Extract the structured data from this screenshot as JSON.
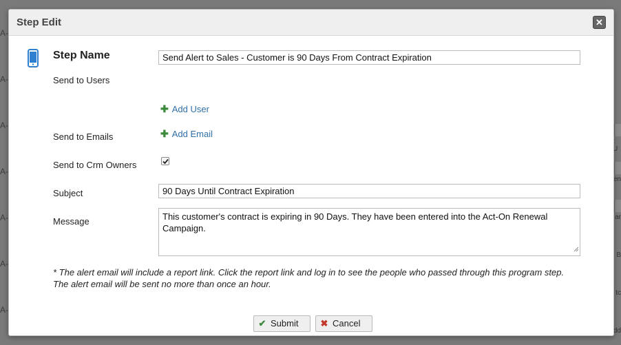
{
  "background": {
    "left_fragments": [
      "A-",
      "A-",
      "A-",
      "A-",
      "A-",
      "A-",
      "A-"
    ],
    "right_fragments": [
      "t U",
      "en",
      "ar",
      "B",
      "tc",
      "dd"
    ]
  },
  "dialog": {
    "title": "Step Edit",
    "close_label": "✕"
  },
  "form": {
    "step_name_label": "Step Name",
    "step_name_value": "Send Alert to Sales - Customer is 90 Days From Contract Expiration",
    "send_to_users_label": "Send to Users",
    "add_user_label": "Add User",
    "send_to_emails_label": "Send to Emails",
    "add_email_label": "Add Email",
    "send_to_crm_owners_label": "Send to Crm Owners",
    "send_to_crm_owners_checked": true,
    "subject_label": "Subject",
    "subject_value": "90 Days Until Contract Expiration",
    "message_label": "Message",
    "message_value": "This customer's contract is expiring in 90 Days. They have been entered into the  Act-On Renewal Campaign."
  },
  "note": {
    "line1": "* The alert email will include a report link. Click the report link and log in to see the people who passed through this program step.",
    "line2": "The alert email will be sent no more than once an hour."
  },
  "buttons": {
    "submit_label": "Submit",
    "cancel_label": "Cancel"
  },
  "colors": {
    "link": "#2f6fa8",
    "plus_icon": "#3b8a3b",
    "phone_icon": "#2f7fd0",
    "cancel_icon": "#c0392b",
    "submit_icon": "#3b8a3b"
  }
}
